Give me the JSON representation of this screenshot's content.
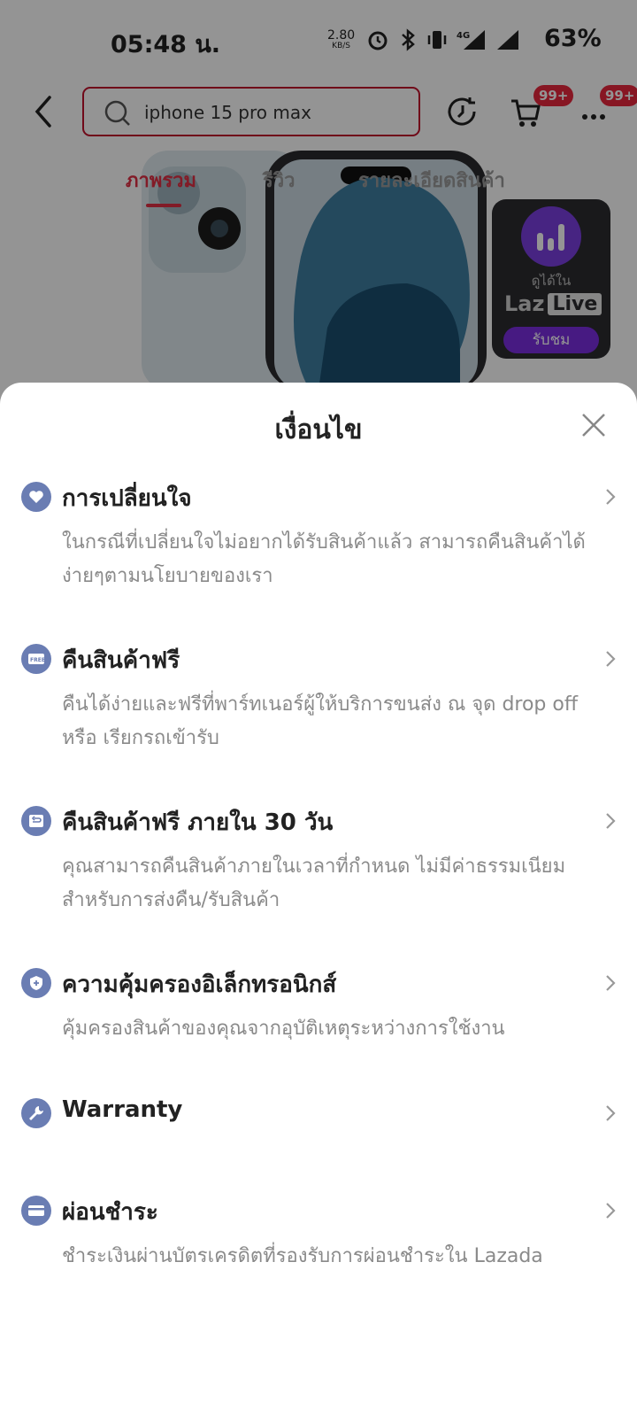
{
  "status_bar": {
    "time": "05:48 น.",
    "net_speed": "2.80",
    "net_unit": "KB/S",
    "battery": "63%"
  },
  "header": {
    "search_text": "iphone 15 pro max",
    "cart_badge": "99+",
    "more_badge": "99+"
  },
  "tabs": [
    {
      "label": "ภาพรวม",
      "active": true
    },
    {
      "label": "รีวิว",
      "active": false
    },
    {
      "label": "รายละเอียดสินค้า",
      "active": false
    }
  ],
  "live_card": {
    "caption": "ดูได้ใน",
    "brand_a": "Laz",
    "brand_b": "Live",
    "button": "รับชม"
  },
  "sheet": {
    "title": "เงื่อนไข",
    "items": [
      {
        "icon": "heart-icon",
        "title": "การเปลี่ยนใจ",
        "desc": "ในกรณีที่เปลี่ยนใจไม่อยากได้รับสินค้าแล้ว สามารถคืนสินค้าได้ง่ายๆตามนโยบายของเรา"
      },
      {
        "icon": "free-return-icon",
        "title": "คืนสินค้าฟรี",
        "desc": "คืนได้ง่ายและฟรีที่พาร์ทเนอร์ผู้ให้บริการขนส่ง ณ จุด drop off หรือ เรียกรถเข้ารับ"
      },
      {
        "icon": "return-box-icon",
        "title": "คืนสินค้าฟรี ภายใน 30 วัน",
        "desc": "คุณสามารถคืนสินค้าภายในเวลาที่กำหนด ไม่มีค่าธรรมเนียมสำหรับการส่งคืน/รับสินค้า"
      },
      {
        "icon": "shield-icon",
        "title": "ความคุ้มครองอิเล็กทรอนิกส์",
        "desc": "คุ้มครองสินค้าของคุณจากอุบัติเหตุระหว่างการใช้งาน"
      },
      {
        "icon": "wrench-icon",
        "title": "Warranty",
        "desc": ""
      },
      {
        "icon": "card-icon",
        "title": "ผ่อนชำระ",
        "desc": "ชำระเงินผ่านบัตรเครดิตที่รองรับการผ่อนชำระใน Lazada"
      }
    ]
  }
}
